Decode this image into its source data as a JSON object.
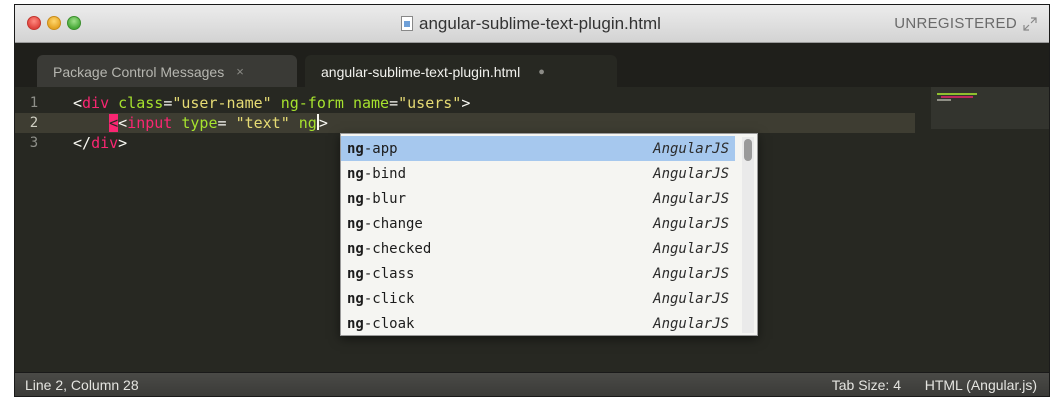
{
  "window": {
    "title": "angular-sublime-text-plugin.html",
    "unregistered": "UNREGISTERED"
  },
  "tabs": [
    {
      "label": "Package Control Messages",
      "close": "×"
    },
    {
      "label": "angular-sublime-text-plugin.html",
      "dirty": "●"
    }
  ],
  "editor": {
    "line_numbers": [
      "1",
      "2",
      "3"
    ],
    "lines": [
      {
        "parts": [
          {
            "cls": "punc",
            "text": "<"
          },
          {
            "cls": "tag",
            "text": "div"
          },
          {
            "cls": "punc",
            "text": " "
          },
          {
            "cls": "attr",
            "text": "class"
          },
          {
            "cls": "punc",
            "text": "="
          },
          {
            "cls": "str",
            "text": "\"user-name\""
          },
          {
            "cls": "punc",
            "text": " "
          },
          {
            "cls": "attr",
            "text": "ng-form"
          },
          {
            "cls": "punc",
            "text": " "
          },
          {
            "cls": "attr",
            "text": "name"
          },
          {
            "cls": "punc",
            "text": "="
          },
          {
            "cls": "str",
            "text": "\"users\""
          },
          {
            "cls": "punc",
            "text": ">"
          }
        ]
      },
      {
        "parts": [
          {
            "cls": "punc",
            "text": "    "
          },
          {
            "cls": "caret-mark",
            "text": "<"
          },
          {
            "cls": "punc",
            "text": "<"
          },
          {
            "cls": "tag",
            "text": "input"
          },
          {
            "cls": "punc",
            "text": " "
          },
          {
            "cls": "attr",
            "text": "type"
          },
          {
            "cls": "punc",
            "text": "= "
          },
          {
            "cls": "str",
            "text": "\"text\""
          },
          {
            "cls": "punc",
            "text": " "
          },
          {
            "cls": "attr",
            "text": "ng"
          },
          {
            "cls": "punc",
            "text": ">"
          }
        ]
      },
      {
        "parts": [
          {
            "cls": "punc",
            "text": "</"
          },
          {
            "cls": "tag",
            "text": "div"
          },
          {
            "cls": "punc",
            "text": ">"
          }
        ]
      }
    ]
  },
  "autocomplete": {
    "typed": "ng",
    "items": [
      {
        "rest": "-app",
        "kind": "AngularJS",
        "selected": true
      },
      {
        "rest": "-bind",
        "kind": "AngularJS"
      },
      {
        "rest": "-blur",
        "kind": "AngularJS"
      },
      {
        "rest": "-change",
        "kind": "AngularJS"
      },
      {
        "rest": "-checked",
        "kind": "AngularJS"
      },
      {
        "rest": "-class",
        "kind": "AngularJS"
      },
      {
        "rest": "-click",
        "kind": "AngularJS"
      },
      {
        "rest": "-cloak",
        "kind": "AngularJS"
      }
    ]
  },
  "status": {
    "position": "Line 2, Column 28",
    "tab_size": "Tab Size: 4",
    "syntax": "HTML (Angular.js)"
  }
}
